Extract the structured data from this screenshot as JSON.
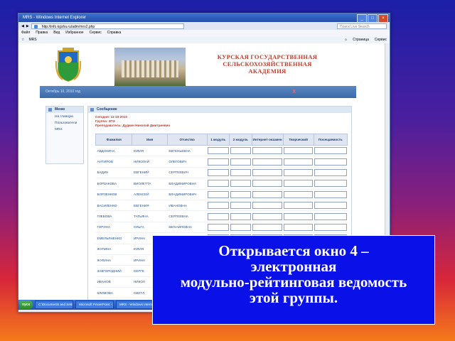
{
  "window": {
    "title": "MRS - Windows Internet Explorer",
    "address": "http://info.kgsha.ru/adm/mrs2.php",
    "search_placeholder": "Поиск Live Search",
    "menu": [
      "Файл",
      "Правка",
      "Вид",
      "Избранное",
      "Сервис",
      "Справка"
    ],
    "fav_label": "MRS",
    "fav_right": [
      "Страница",
      "Сервис"
    ],
    "status": "Готово"
  },
  "site": {
    "academy_lines": [
      "КУРСКАЯ ГОСУДАРСТВЕННАЯ",
      "СЕЛЬСКОХОЗЯЙСТВЕННАЯ",
      "АКАДЕМИЯ"
    ],
    "date": "Октябрь 10, 2010 год",
    "logout": "X"
  },
  "menu": {
    "title": "Меню",
    "items": [
      "На главную",
      "Пользователи",
      "MRS"
    ]
  },
  "message": {
    "title": "Сообщение",
    "lines": [
      "Сегодня: 11-10-2010",
      "Группа: 3ПЭ",
      "Преподаватель: Дудкин Николай Дмитриевич"
    ]
  },
  "table": {
    "headers": [
      "Фамилия",
      "Имя",
      "Отчество",
      "1 модуль",
      "2 модуль",
      "Интернет-экзамен",
      "Творческий",
      "Посещаемость"
    ],
    "rows": [
      [
        "АВДОХИНА",
        "ЮЛИЯ",
        "ЕВГЕНЬЕВНА"
      ],
      [
        "АНТИПОВ",
        "НИКОЛАЙ",
        "ОЛЕГОВИЧ"
      ],
      [
        "БАДИН",
        "ЕВГЕНИЙ",
        "СЕРГЕЕВИЧ"
      ],
      [
        "БОРЗАКОВА",
        "ВИОЛЕТТА",
        "ВЛАДИМИРОВНА"
      ],
      [
        "БОРЗЕНКОВ",
        "АЛЕКСЕЙ",
        "ВЛАДИМИРОВИЧ"
      ],
      [
        "ВАСИЛЕНКО",
        "ЕВГЕНИЯ",
        "ИВАНОВНА"
      ],
      [
        "ГЛЕБОВА",
        "ТАТЬЯНА",
        "СЕРГЕЕВНА"
      ],
      [
        "ГОРИНА",
        "ОЛЬГА",
        "МИХАЙЛОВНА"
      ],
      [
        "ЕМЕЛЬЯНЕНКО",
        "ИРИНА",
        "АНАТОЛЬЕВНА"
      ],
      [
        "ЖУЛИНА",
        "ЮЛИЯ",
        "ВАЛЕРЬЕВНА"
      ],
      [
        "ЖУКИНА",
        "ИРИНА",
        ""
      ],
      [
        "ЗАВГОРОДНИЙ",
        "СЕРГЕ",
        ""
      ],
      [
        "ИВАНОВ",
        "НИКОЛ",
        ""
      ],
      [
        "КЛИМОВА",
        "СВЕТЛ",
        ""
      ],
      [
        "КОРОВИНА",
        "ТАТЬЯ",
        ""
      ],
      [
        "НОВИКОВА",
        "ДИНА",
        ""
      ],
      [
        "ПАЛАГИНА",
        "ЕКАТЕ",
        ""
      ]
    ]
  },
  "taskbar": {
    "start": "пуск",
    "tasks": [
      "C:\\Documents and Settin...",
      "Microsoft PowerPoint - [...",
      "MRS - Windows Internet..."
    ]
  },
  "callout": {
    "lines": [
      "Открывается окно 4 –",
      "электронная",
      "модульно-рейтинговая ведомость",
      "этой группы."
    ]
  }
}
